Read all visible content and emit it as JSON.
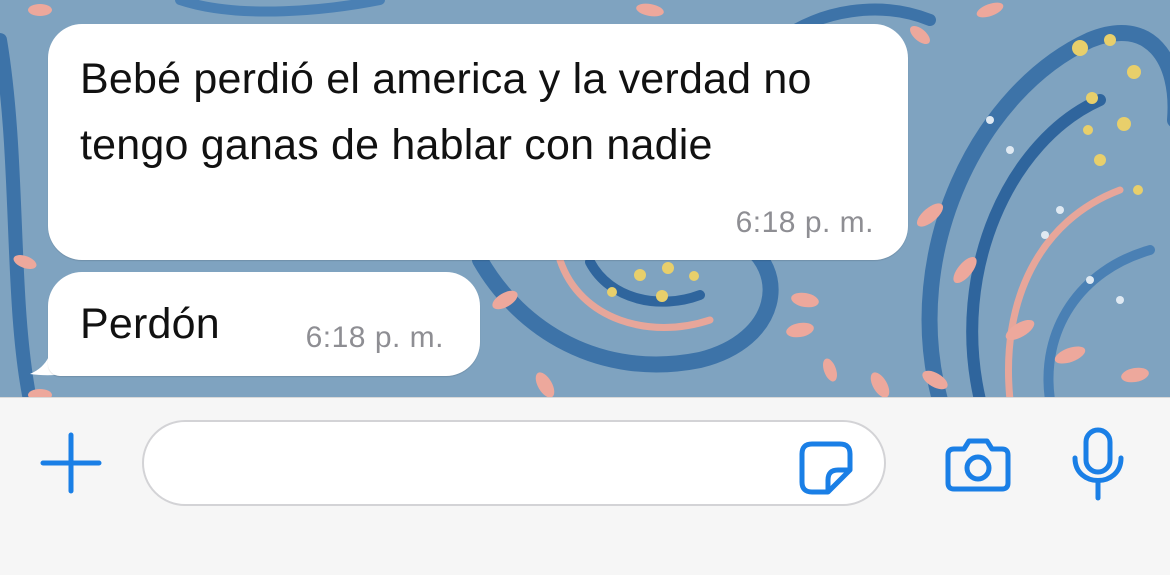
{
  "colors": {
    "accent": "#1a7fe6",
    "bubble": "#ffffff",
    "timestamp": "#8e8e93",
    "wallpaper": "#7fa3c0"
  },
  "messages": [
    {
      "text": "Bebé perdió el america y la verdad no tengo ganas de hablar con nadie",
      "time": "6:18 p. m."
    },
    {
      "text": "Perdón",
      "time": "6:18 p. m."
    }
  ],
  "input_bar": {
    "message_value": "",
    "icons": [
      "plus-icon",
      "sticker-icon",
      "camera-icon",
      "microphone-icon"
    ]
  }
}
